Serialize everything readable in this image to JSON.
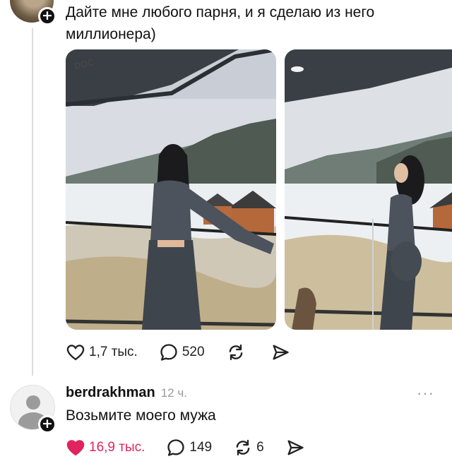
{
  "post": {
    "text": "Дайте мне любого парня, и я сделаю из него миллионера)",
    "watermark": "DDC",
    "likes": "1,7 тыс.",
    "comments": "520"
  },
  "reply": {
    "username": "berdrakhman",
    "time": "12 ч.",
    "more": "···",
    "text": "Возьмите моего мужа",
    "likes": "16,9 тыс.",
    "comments": "149",
    "reposts": "6"
  },
  "colors": {
    "like_active": "#e0245e",
    "text": "#111111",
    "muted": "#9a9a9a"
  },
  "icons": [
    "heart-icon",
    "comment-icon",
    "repost-icon",
    "share-icon",
    "plus-icon",
    "avatar-placeholder-icon"
  ]
}
